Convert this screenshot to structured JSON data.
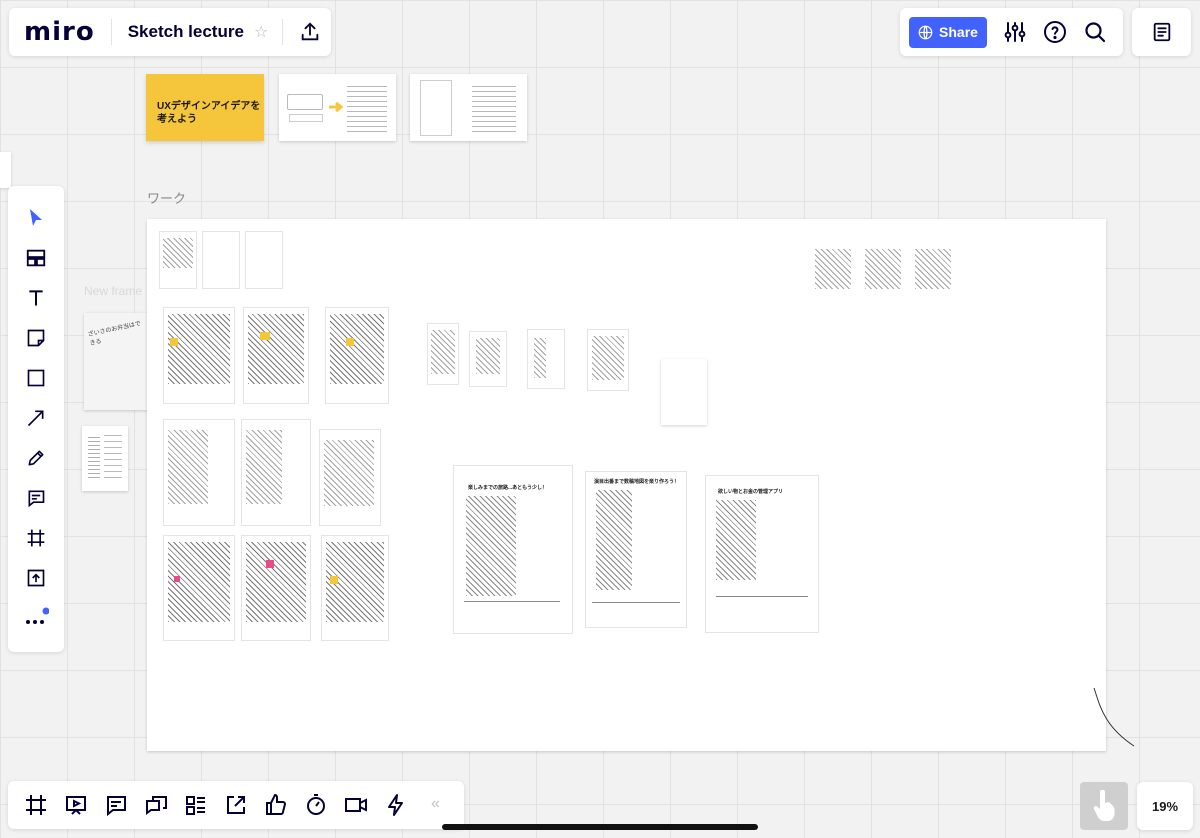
{
  "app": {
    "logo": "miro",
    "board_title": "Sketch lecture"
  },
  "header_right": {
    "share_label": "Share"
  },
  "canvas": {
    "sticky_text": "UXデザインアイデアを考えよう",
    "section_label": "ワーク",
    "ghost_frame_label": "New frame",
    "handwritten_note": "ざいさのお弁当はできる",
    "sheet_titles": [
      "楽しみまでの旅路...あともう少し！",
      "演目出番まで数稿地図を楽り作ろう！",
      "欲しい物とお金の管理アプリ"
    ]
  },
  "zoom": {
    "level": "19%"
  },
  "icons": [
    "select-icon",
    "templates-icon",
    "text-icon",
    "sticky-note-icon",
    "shape-icon",
    "arrow-icon",
    "pen-icon",
    "comment-icon",
    "frame-icon",
    "upload-icon",
    "more-icon"
  ]
}
